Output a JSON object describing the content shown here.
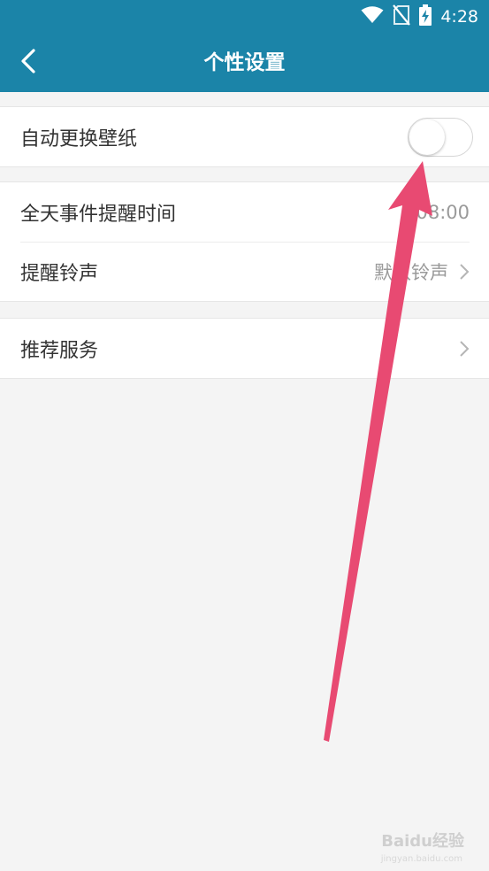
{
  "status_bar": {
    "time": "4:28",
    "icons": [
      "wifi-icon",
      "no-sim-icon",
      "battery-charging-icon"
    ]
  },
  "app_bar": {
    "title": "个性设置",
    "back_icon": "back-chevron-icon"
  },
  "groups": [
    {
      "rows": [
        {
          "label": "自动更换壁纸",
          "control": "switch",
          "switch_on": false
        }
      ]
    },
    {
      "rows": [
        {
          "label": "全天事件提醒时间",
          "value": "08:00"
        },
        {
          "label": "提醒铃声",
          "value": "默认铃声",
          "chevron": true
        }
      ]
    },
    {
      "rows": [
        {
          "label": "推荐服务",
          "chevron": true
        }
      ]
    }
  ],
  "colors": {
    "primary": "#1b84a8",
    "background": "#f4f4f4",
    "annotation_arrow": "#e84a72"
  },
  "watermark": {
    "brand": "Baidu经验",
    "url": "jingyan.baidu.com"
  }
}
